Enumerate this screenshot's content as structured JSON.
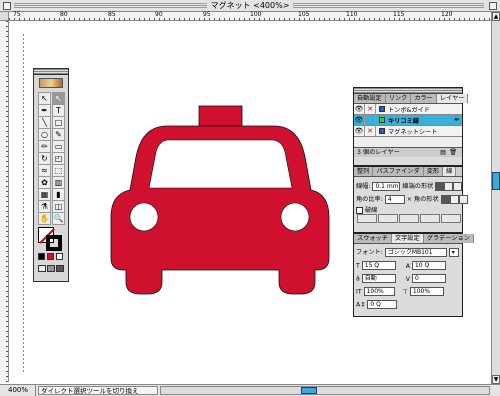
{
  "window": {
    "title": "マグネット <400%>"
  },
  "ruler": {
    "labels": [
      "75",
      "80",
      "85",
      "90",
      "95",
      "100",
      "105",
      "110",
      "115",
      "120"
    ]
  },
  "status": {
    "zoom": "400%",
    "hint": "ダイレクト選択ツールを切り換え"
  },
  "toolbox": {
    "tools": [
      {
        "name": "selection-tool",
        "glyph": "↖"
      },
      {
        "name": "direct-selection-tool",
        "glyph": "↖"
      },
      {
        "name": "pen-tool",
        "glyph": "✒"
      },
      {
        "name": "type-tool",
        "glyph": "T"
      },
      {
        "name": "line-tool",
        "glyph": "╲"
      },
      {
        "name": "rectangle-tool",
        "glyph": "□"
      },
      {
        "name": "ellipse-tool",
        "glyph": "○"
      },
      {
        "name": "brush-tool",
        "glyph": "✎"
      },
      {
        "name": "pencil-tool",
        "glyph": "✏"
      },
      {
        "name": "eraser-tool",
        "glyph": "▭"
      },
      {
        "name": "rotate-tool",
        "glyph": "↻"
      },
      {
        "name": "scale-tool",
        "glyph": "◰"
      },
      {
        "name": "warp-tool",
        "glyph": "≈"
      },
      {
        "name": "free-transform-tool",
        "glyph": "⬚"
      },
      {
        "name": "symbol-tool",
        "glyph": "✿"
      },
      {
        "name": "graph-tool",
        "glyph": "▥"
      },
      {
        "name": "mesh-tool",
        "glyph": "▦"
      },
      {
        "name": "gradient-tool",
        "glyph": "▮"
      },
      {
        "name": "eyedropper-tool",
        "glyph": "⚗"
      },
      {
        "name": "blend-tool",
        "glyph": "◫"
      },
      {
        "name": "hand-tool",
        "glyph": "✋"
      },
      {
        "name": "zoom-tool",
        "glyph": "🔍"
      }
    ]
  },
  "layers_panel": {
    "tabs": [
      "自動設定",
      "リンク",
      "カラー",
      "レイヤー"
    ],
    "layers": [
      {
        "name": "トンボ&ガイド",
        "color": "#3355cc",
        "selected": false
      },
      {
        "name": "キリコミ線",
        "color": "#33cc33",
        "selected": true
      },
      {
        "name": "マグネットシート",
        "color": "#3355cc",
        "selected": false
      }
    ],
    "count": "3 個のレイヤー"
  },
  "stroke_panel": {
    "tabs": [
      "整列",
      "パスファインダ",
      "変形",
      "線"
    ],
    "weight_label": "線幅:",
    "weight_value": "0.1 mm",
    "cap_label": "線端の形状",
    "miter_label": "角の比率:",
    "miter_value": "4",
    "join_label": "× 角の形状",
    "dash_label": "破線",
    "dash_labels": [
      "線分",
      "間隔",
      "線分",
      "間隔",
      "線分",
      "間隔"
    ]
  },
  "char_panel": {
    "tabs": [
      "スウォッチ",
      "文字設定",
      "グラデーション"
    ],
    "font_label": "フォント:",
    "font_value": "ゴシックMB101",
    "size": "15 Q",
    "leading": "10 Q",
    "tracking": "自動",
    "kerning": "0",
    "vscale": "100%",
    "hscale": "100%",
    "baseline": "0 Q"
  },
  "colors": {
    "taxi": "#d0102f",
    "selection": "#3ab0d8"
  }
}
